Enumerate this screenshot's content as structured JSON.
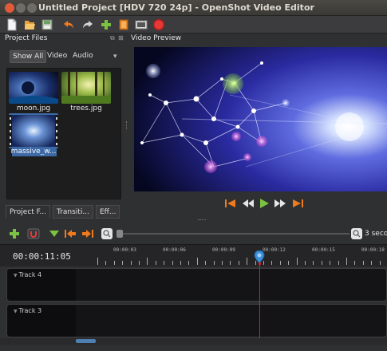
{
  "window": {
    "title": "Untitled Project [HDV 720 24p] - OpenShot Video Editor"
  },
  "toolbar": {
    "icons": [
      "new-project-icon",
      "open-project-icon",
      "save-project-icon",
      "undo-icon",
      "redo-icon",
      "import-files-icon",
      "profile-icon",
      "export-video-icon",
      "record-icon"
    ]
  },
  "project_files": {
    "title": "Project Files",
    "filter_tabs": [
      "Show All",
      "Video",
      "Audio"
    ],
    "selected_filter": "Show All",
    "files": [
      {
        "name": "moon.jpg"
      },
      {
        "name": "trees.jpg"
      },
      {
        "name": "massive_w..."
      }
    ],
    "bottom_tabs": [
      "Project F...",
      "Transiti...",
      "Eff..."
    ]
  },
  "video_preview": {
    "title": "Video Preview"
  },
  "timeline": {
    "timecode": "00:00:11:05",
    "zoom_label": "3 secor",
    "ruler_labels": [
      "00:00:03",
      "00:00:06",
      "00:00:09",
      "00:00:12",
      "00:00:15",
      "00:00:18"
    ],
    "tracks": [
      {
        "name": "Track 4"
      },
      {
        "name": "Track 3"
      }
    ]
  },
  "colors": {
    "accent_orange": "#f07a1e",
    "play_green": "#7cc242",
    "playhead_red": "#d21f2c",
    "selection_blue": "#3d6aa6"
  }
}
